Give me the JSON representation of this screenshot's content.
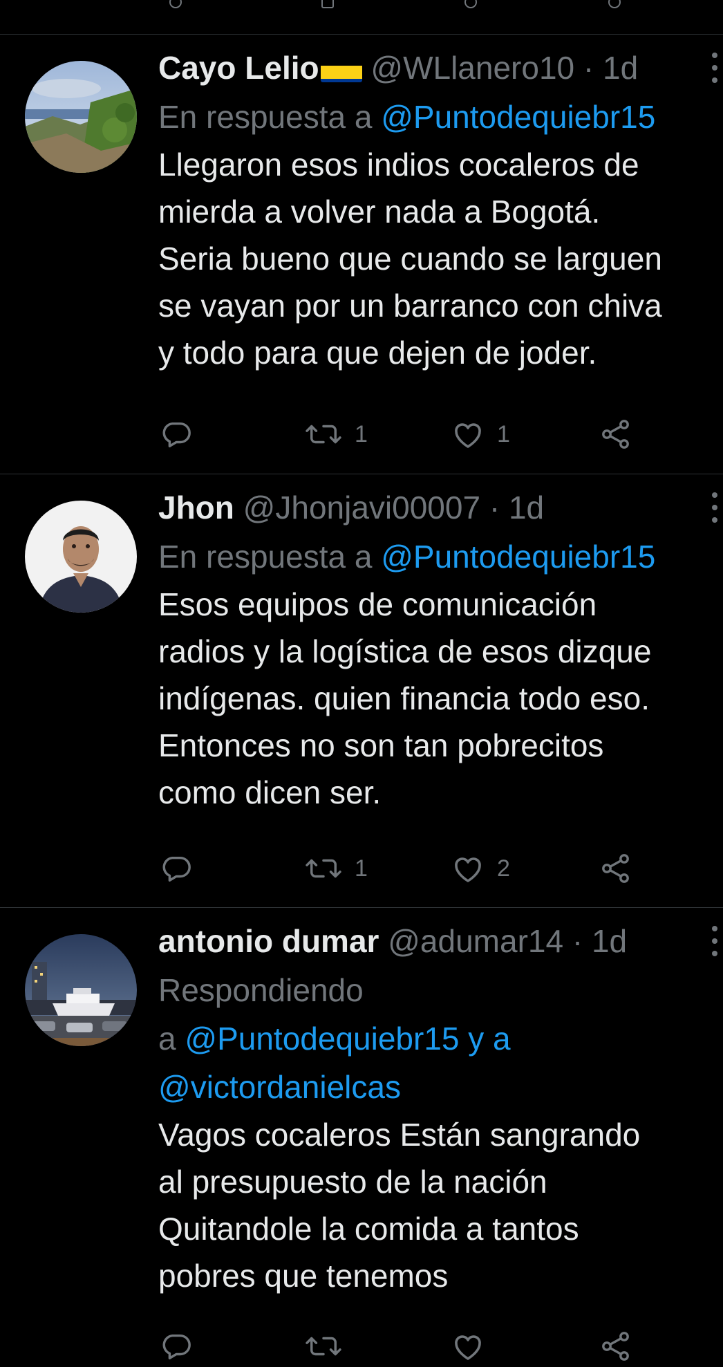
{
  "tweets": [
    {
      "name": "Cayo Lelio",
      "has_flag": true,
      "flag_colors": [
        "#fcd116",
        "#003893",
        "#ce1126"
      ],
      "handle": "@WLlanero10",
      "separator": "·",
      "time": "1d",
      "reply_prefix": "En respuesta a",
      "reply_mentions": "@Puntodequiebr15",
      "text": "Llegaron esos indios cocaleros de\nmierda a volver nada a Bogotá.\nSeria bueno que cuando se larguen\nse vayan por un barranco con chiva\ny todo para que dejen de joder.",
      "replies": "",
      "retweets": "1",
      "likes": "1",
      "avatar": "landscape-photo"
    },
    {
      "name": "Jhon",
      "has_flag": false,
      "handle": "@Jhonjavi00007",
      "separator": "·",
      "time": "1d",
      "reply_prefix": "En respuesta a",
      "reply_mentions": "@Puntodequiebr15",
      "text": "Esos equipos de comunicación\nradios y la logística de esos dizque\nindígenas.  quien financia todo eso.\nEntonces no son tan pobrecitos\ncomo dicen ser.",
      "replies": "",
      "retweets": "1",
      "likes": "2",
      "avatar": "man-portrait-photo"
    },
    {
      "name": "antonio dumar",
      "has_flag": false,
      "handle": "@adumar14",
      "separator": "·",
      "time": "1d",
      "reply_prefix_line1": "Respondiendo",
      "reply_prefix_line2": "a",
      "reply_mentions_line2": "@Puntodequiebr15 y a",
      "reply_mentions_line3": "@victordanielcas",
      "text": "Vagos cocaleros Están sangrando\nal presupuesto de la nación\nQuitandole la comida a tantos\npobres que tenemos",
      "avatar": "yacht-harbor-photo"
    }
  ],
  "colors": {
    "background": "#000000",
    "text": "#e7e9ea",
    "secondary": "#71767b",
    "link": "#1d9bf0",
    "divider": "#2f3336"
  },
  "icons": [
    "reply-icon",
    "retweet-icon",
    "like-icon",
    "share-icon",
    "more-icon"
  ]
}
